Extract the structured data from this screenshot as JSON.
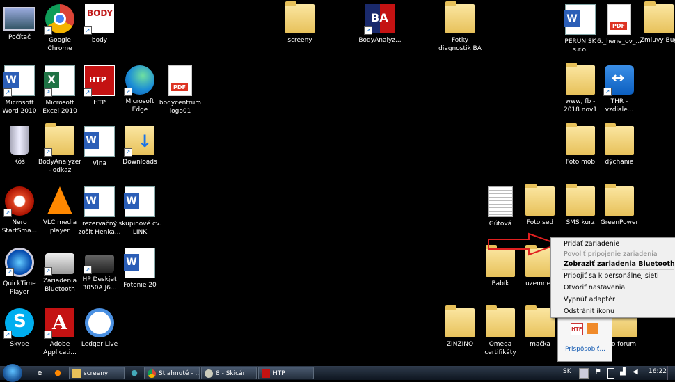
{
  "desktop": {
    "icons": [
      {
        "label": "Počítač",
        "glyph": "computer-icon"
      },
      {
        "label": "Google\nChrome",
        "glyph": "chrome-icon"
      },
      {
        "label": "body",
        "glyph": "bodycentrum-icon",
        "logo_text": "BODY"
      },
      {
        "label": "screeny",
        "glyph": "folder-icon"
      },
      {
        "label": "BodyAnalyz...",
        "glyph": "bodyanalyzer-icon",
        "logo_text": "BA"
      },
      {
        "label": "Fotky\ndiagnostik BA",
        "glyph": "folder-icon"
      },
      {
        "label": "PERUN SK\ns.r.o.",
        "glyph": "word-icon"
      },
      {
        "label": "6._hene_ov_...",
        "glyph": "pdf-icon"
      },
      {
        "label": "Zmluvy Bug",
        "glyph": "folder-icon"
      },
      {
        "label": "Microsoft\nWord 2010",
        "glyph": "word-icon"
      },
      {
        "label": "Microsoft\nExcel 2010",
        "glyph": "excel-icon"
      },
      {
        "label": "HTP",
        "glyph": "htp-icon",
        "logo_text": "HTP"
      },
      {
        "label": "Microsoft\nEdge",
        "glyph": "edge-icon"
      },
      {
        "label": "bodycentrum\nlogo01",
        "glyph": "pdf-icon"
      },
      {
        "label": "www, fb -\n2018 nov1",
        "glyph": "folder-icon"
      },
      {
        "label": "THR -\nvzdiale...",
        "glyph": "teamviewer-icon"
      },
      {
        "label": "Kôš",
        "glyph": "recycle-bin-icon"
      },
      {
        "label": "BodyAnalyzer\n- odkaz",
        "glyph": "folder-icon"
      },
      {
        "label": "Vlna",
        "glyph": "word-icon"
      },
      {
        "label": "Downloads",
        "glyph": "downloads-icon"
      },
      {
        "label": "Foto mob",
        "glyph": "folder-icon"
      },
      {
        "label": "dýchanie",
        "glyph": "folder-icon"
      },
      {
        "label": "Nero\nStartSma...",
        "glyph": "nero-icon"
      },
      {
        "label": "VLC media\nplayer",
        "glyph": "vlc-icon"
      },
      {
        "label": "rezervačný\nzošit Henka...",
        "glyph": "word-icon"
      },
      {
        "label": "skupinové cv.\nLINK",
        "glyph": "word-icon"
      },
      {
        "label": "Gútová",
        "glyph": "document-icon"
      },
      {
        "label": "Foto sed",
        "glyph": "folder-icon"
      },
      {
        "label": "SMS kurz",
        "glyph": "folder-icon"
      },
      {
        "label": "GreenPower",
        "glyph": "folder-icon"
      },
      {
        "label": "QuickTime\nPlayer",
        "glyph": "quicktime-icon"
      },
      {
        "label": "Zariadenia\nBluetooth",
        "glyph": "printer-icon"
      },
      {
        "label": "HP Deskjet\n3050A J6...",
        "glyph": "hp-printer-icon"
      },
      {
        "label": "Fotenie 20",
        "glyph": "word-icon"
      },
      {
        "label": "Babík",
        "glyph": "folder-icon"
      },
      {
        "label": "uzemnen",
        "glyph": "folder-icon"
      },
      {
        "label": "Skype",
        "glyph": "skype-icon"
      },
      {
        "label": "Adobe\nApplicati...",
        "glyph": "adobe-icon"
      },
      {
        "label": "Ledger Live",
        "glyph": "ledger-icon"
      },
      {
        "label": "ZINZINO",
        "glyph": "folder-icon"
      },
      {
        "label": "Omega\ncertifikáty",
        "glyph": "folder-icon"
      },
      {
        "label": "mačka",
        "glyph": "folder-icon"
      },
      {
        "label": "ko forum",
        "glyph": "folder-icon"
      }
    ]
  },
  "context_menu": {
    "items": [
      {
        "label": "Pridať zariadenie",
        "state": "normal"
      },
      {
        "label": "Povoliť pripojenie zariadenia",
        "state": "disabled"
      },
      {
        "label": "Zobraziť zariadenia Bluetooth",
        "state": "bold"
      },
      {
        "label": "Pripojiť sa k personálnej sieti",
        "state": "normal"
      },
      {
        "label": "Otvoriť nastavenia",
        "state": "normal"
      },
      {
        "label": "Vypnúť adaptér",
        "state": "normal"
      },
      {
        "label": "Odstrániť ikonu",
        "state": "normal"
      }
    ]
  },
  "tray_popup": {
    "customize_label": "Prispôsobiť...",
    "icon1_text": "HTP"
  },
  "taskbar": {
    "tasks": [
      {
        "label": "screeny",
        "icon": "folder-icon"
      },
      {
        "label": "Stiahnuté - ...",
        "icon": "chrome-icon"
      },
      {
        "label": "8 - Skicár",
        "icon": "paint-icon"
      },
      {
        "label": "HTP",
        "icon": "htp-icon"
      }
    ],
    "language": "SK",
    "clock": "16:22"
  },
  "colors": {
    "annotation_arrow": "#e02020",
    "menu_bg": "#f0f0f0",
    "taskbar": "#1b2533"
  }
}
